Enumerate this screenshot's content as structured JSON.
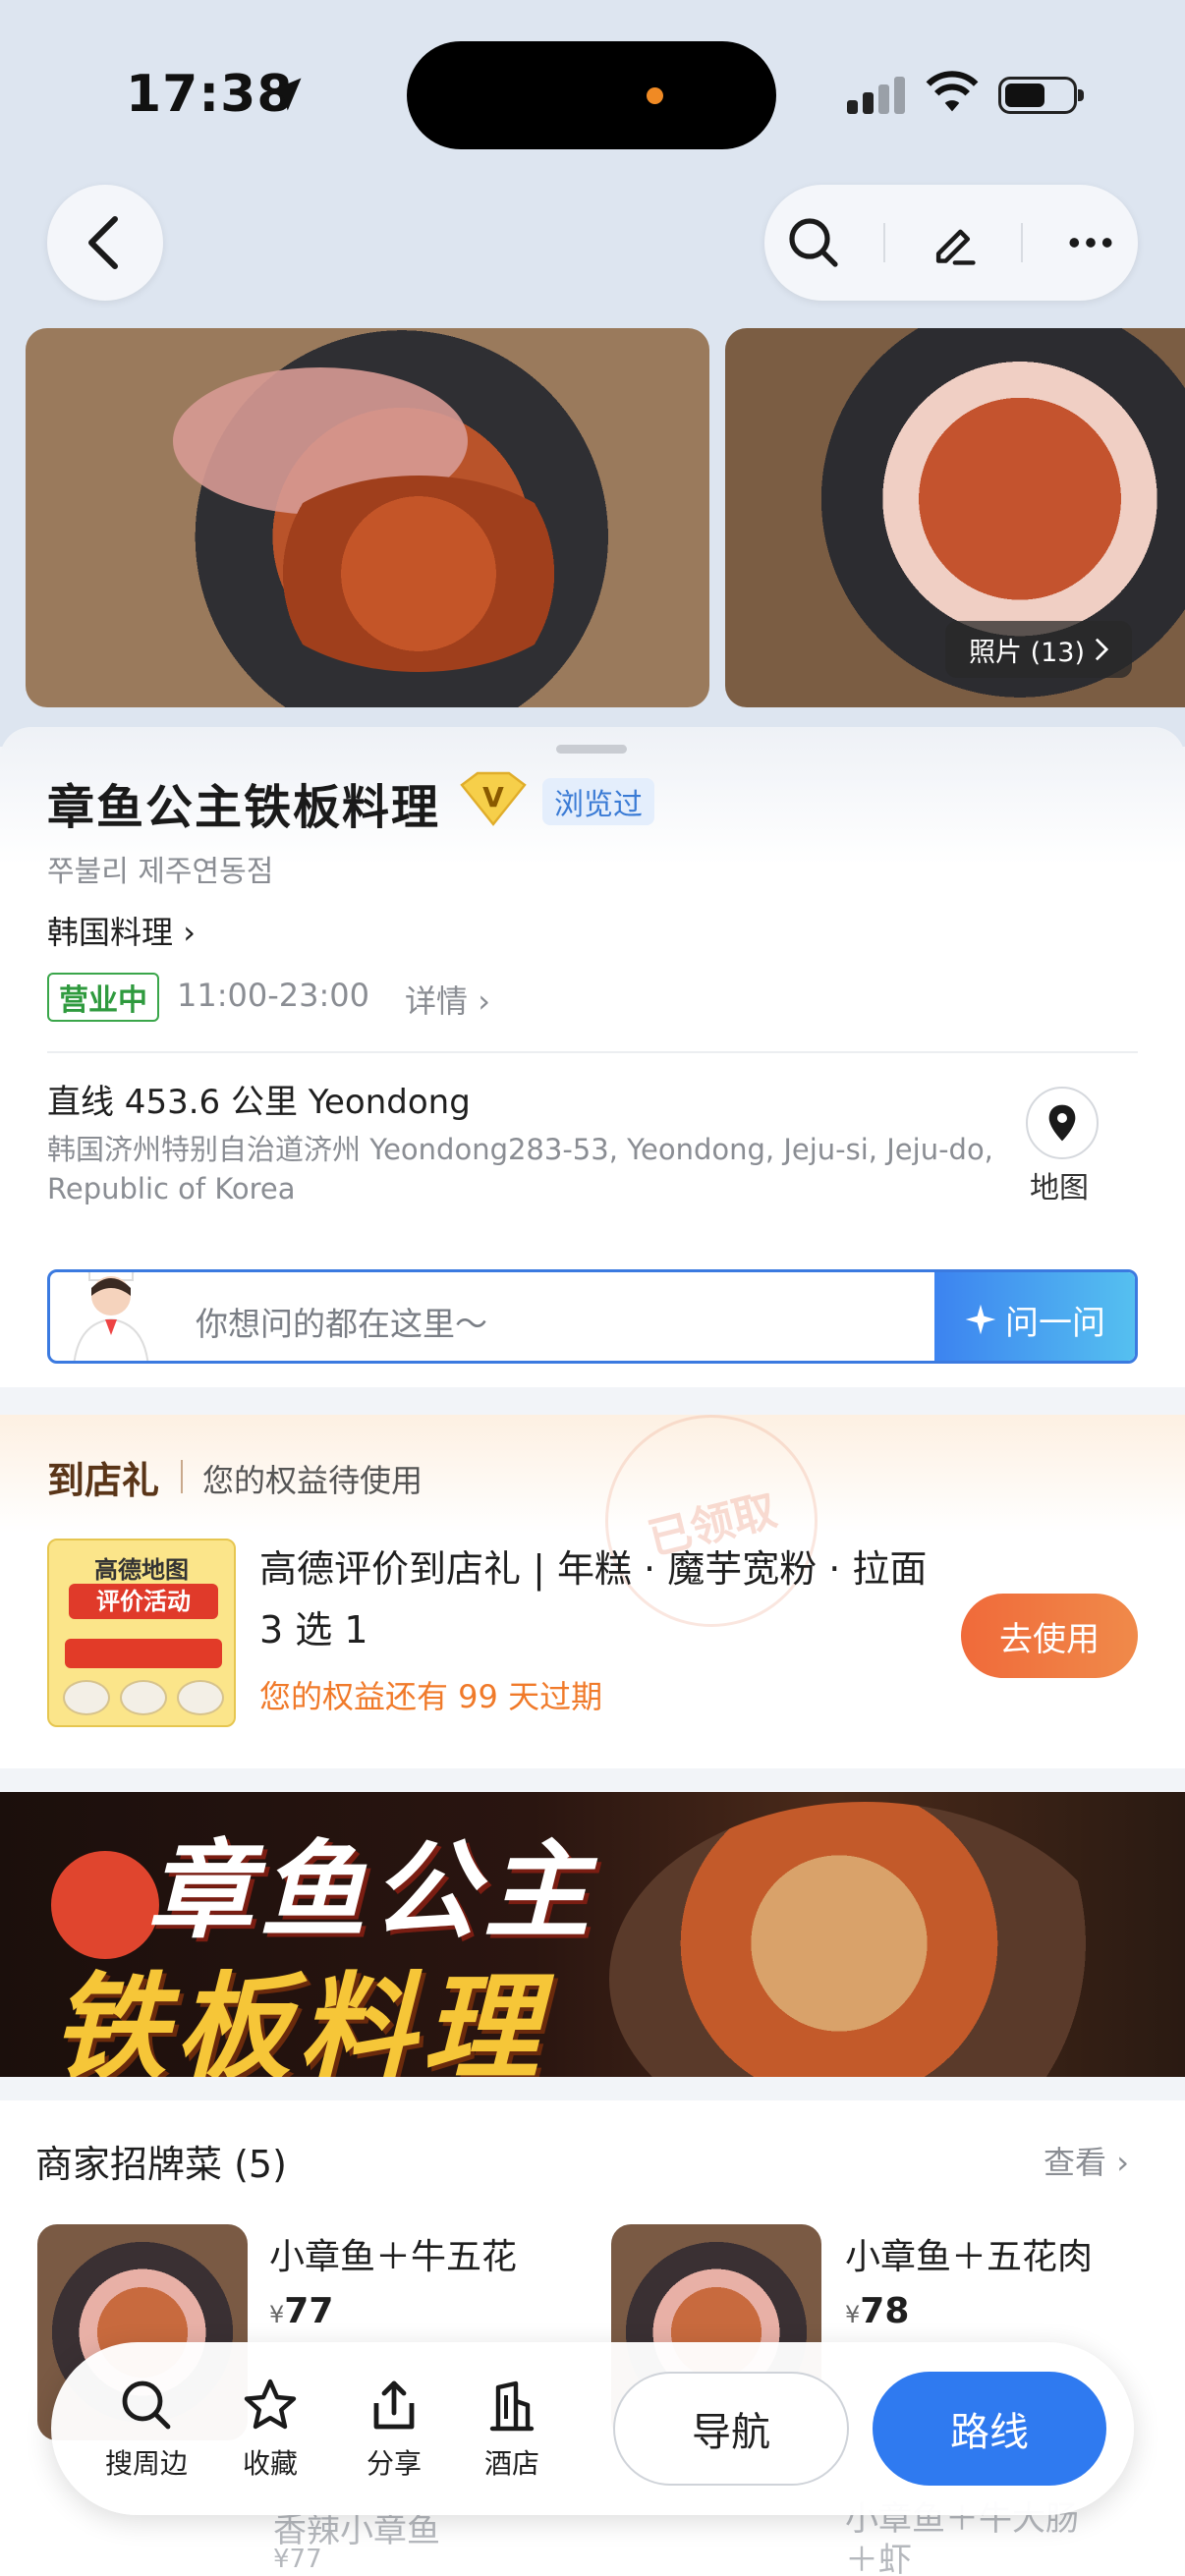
{
  "status_bar": {
    "time": "17:38"
  },
  "photos": {
    "badge_label": "照片 (13)"
  },
  "place": {
    "name": "章鱼公主铁板料理",
    "browsed_tag": "浏览过",
    "local_name": "쭈불리 제주연동점",
    "category": "韩国料理",
    "open_status": "营业中",
    "hours": "11:00-23:00",
    "details_link": "详情",
    "distance": "直线 453.6 公里 Yeondong",
    "address": "韩国济州特别自治道济州 Yeondong283-53, Yeondong, Jeju-si, Jeju-do, Republic of Korea",
    "map_label": "地图"
  },
  "ask": {
    "placeholder": "你想问的都在这里～",
    "button_label": "问一问"
  },
  "coupon": {
    "brand": "到店礼",
    "subtitle": "您的权益待使用",
    "stamp": "已领取",
    "image_title": "高德地图",
    "image_tag": "评价活动",
    "title": "高德评价到店礼 | 年糕 · 魔芋宽粉 · 拉面 3 选 1",
    "expire": "您的权益还有 99 天过期",
    "use_button": "去使用"
  },
  "banner": {
    "line1": "章鱼公主",
    "line2": "铁板料理"
  },
  "dishes": {
    "title": "商家招牌菜 (5)",
    "more": "查看",
    "currency": "¥",
    "items": [
      {
        "name": "小章鱼＋牛五花",
        "price": "77"
      },
      {
        "name": "小章鱼＋五花肉",
        "price": "78"
      }
    ],
    "ghost_items": [
      "香辣小章鱼",
      "¥77",
      "小章鱼＋牛大肠",
      "＋虾"
    ]
  },
  "bottom_bar": {
    "items": [
      "搜周边",
      "收藏",
      "分享",
      "酒店"
    ],
    "nav_button": "导航",
    "route_button": "路线"
  },
  "colors": {
    "accent": "#2f7af0",
    "open_green": "#2f9a3e",
    "coupon_orange": "#f07a2a"
  }
}
